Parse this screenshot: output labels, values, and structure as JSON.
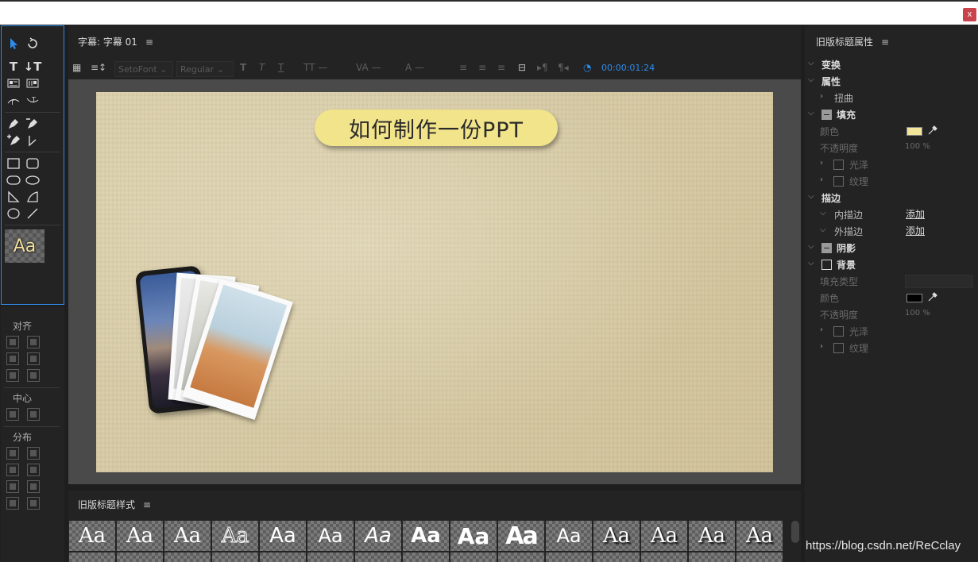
{
  "window": {
    "close_label": "x"
  },
  "tools_panel": {
    "style_swatch_label": "Aa"
  },
  "align_panel": {
    "align_label": "对齐",
    "center_label": "中心",
    "distribute_label": "分布"
  },
  "main_panel": {
    "title": "字幕: 字幕 01",
    "menu_glyph": "≡",
    "font_family": "SetoFont",
    "font_style": "Regular",
    "timecode": "00:00:01:24",
    "canvas_title_text": "如何制作一份PPT"
  },
  "styles_panel": {
    "title": "旧版标题样式",
    "menu_glyph": "≡",
    "swatch_label": "Aa",
    "swatch_count": 15
  },
  "properties_panel": {
    "title": "旧版标题属性",
    "menu_glyph": "≡",
    "rows": {
      "transform": "变换",
      "attributes": "属性",
      "distort": "扭曲",
      "fill": "填充",
      "fill_color": "颜色",
      "fill_opacity": "不透明度",
      "fill_opacity_value": "100 %",
      "fill_sheen": "光泽",
      "fill_texture": "纹理",
      "strokes": "描边",
      "inner_strokes": "内描边",
      "inner_add": "添加",
      "outer_strokes": "外描边",
      "outer_add": "添加",
      "shadow": "阴影",
      "background": "背景",
      "bg_fill_type": "填充类型",
      "bg_color": "颜色",
      "bg_opacity": "不透明度",
      "bg_opacity_value": "100 %",
      "bg_sheen": "光泽",
      "bg_texture": "纹理"
    },
    "fill_color_hex": "#f3e69a",
    "bg_color_hex": "#000000"
  },
  "watermark": "https://blog.csdn.net/ReCclay",
  "colors": {
    "accent": "#2d8ceb",
    "panel_bg": "#232323",
    "pill": "#f2e48a"
  }
}
